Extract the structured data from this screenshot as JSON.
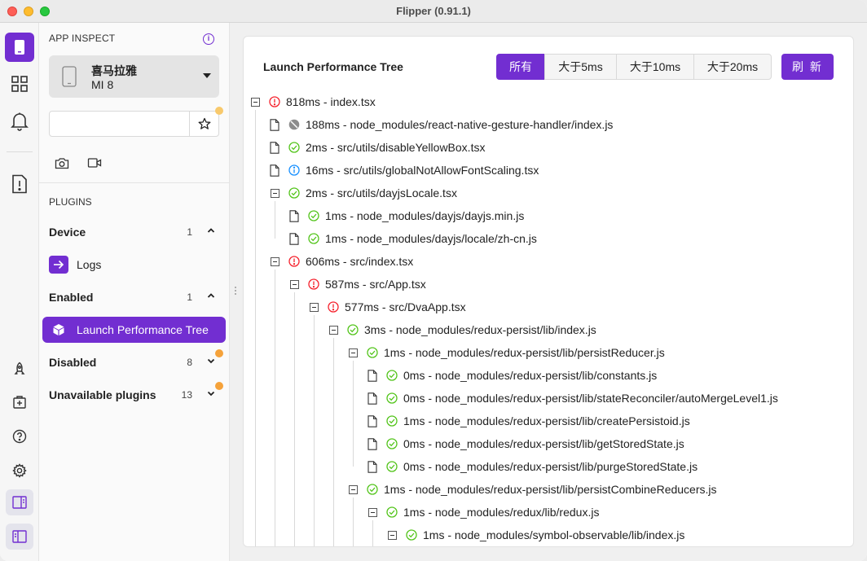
{
  "window": {
    "title": "Flipper (0.91.1)"
  },
  "sidebar": {
    "app_inspect_header": "APP INSPECT",
    "info_icon_glyph": "i",
    "device": {
      "name": "喜马拉雅",
      "model": "MI 8"
    },
    "search": {
      "value": "",
      "placeholder": ""
    },
    "plugins_header": "PLUGINS",
    "groups": {
      "device": {
        "label": "Device",
        "count": "1",
        "expanded": true
      },
      "enabled": {
        "label": "Enabled",
        "count": "1",
        "expanded": true
      },
      "disabled": {
        "label": "Disabled",
        "count": "8",
        "expanded": false
      },
      "unavailable": {
        "label": "Unavailable plugins",
        "count": "13",
        "expanded": false
      }
    },
    "plugins": {
      "logs": {
        "label": "Logs"
      },
      "launch_performance_tree": {
        "label": "Launch Performance Tree",
        "selected": true
      }
    }
  },
  "main": {
    "panel_title": "Launch Performance Tree",
    "filters": [
      {
        "label": "所有",
        "active": true
      },
      {
        "label": "大于5ms",
        "active": false
      },
      {
        "label": "大于10ms",
        "active": false
      },
      {
        "label": "大于20ms",
        "active": false
      }
    ],
    "refresh_label": "刷 新"
  },
  "colors": {
    "accent": "#722ed1",
    "status_error": "#f5222d",
    "status_ok": "#52c41a",
    "status_info": "#1890ff",
    "status_blocked": "#8c8c8c"
  },
  "tree": [
    {
      "depth": 0,
      "kind": "folder",
      "status": "error",
      "label": "818ms - index.tsx"
    },
    {
      "depth": 1,
      "kind": "file",
      "status": "blocked",
      "label": "188ms - node_modules/react-native-gesture-handler/index.js"
    },
    {
      "depth": 1,
      "kind": "file",
      "status": "ok",
      "label": "2ms - src/utils/disableYellowBox.tsx"
    },
    {
      "depth": 1,
      "kind": "file",
      "status": "info",
      "label": "16ms - src/utils/globalNotAllowFontScaling.tsx"
    },
    {
      "depth": 1,
      "kind": "folder",
      "status": "ok",
      "label": "2ms - src/utils/dayjsLocale.tsx"
    },
    {
      "depth": 2,
      "kind": "file",
      "status": "ok",
      "label": "1ms - node_modules/dayjs/dayjs.min.js"
    },
    {
      "depth": 2,
      "kind": "file",
      "status": "ok",
      "label": "1ms - node_modules/dayjs/locale/zh-cn.js"
    },
    {
      "depth": 1,
      "kind": "folder",
      "status": "error",
      "label": "606ms - src/index.tsx"
    },
    {
      "depth": 2,
      "kind": "folder",
      "status": "error",
      "label": "587ms - src/App.tsx"
    },
    {
      "depth": 3,
      "kind": "folder",
      "status": "error",
      "label": "577ms - src/DvaApp.tsx"
    },
    {
      "depth": 4,
      "kind": "folder",
      "status": "ok",
      "label": "3ms - node_modules/redux-persist/lib/index.js"
    },
    {
      "depth": 5,
      "kind": "folder",
      "status": "ok",
      "label": "1ms - node_modules/redux-persist/lib/persistReducer.js"
    },
    {
      "depth": 6,
      "kind": "file",
      "status": "ok",
      "label": "0ms - node_modules/redux-persist/lib/constants.js"
    },
    {
      "depth": 6,
      "kind": "file",
      "status": "ok",
      "label": "0ms - node_modules/redux-persist/lib/stateReconciler/autoMergeLevel1.js"
    },
    {
      "depth": 6,
      "kind": "file",
      "status": "ok",
      "label": "1ms - node_modules/redux-persist/lib/createPersistoid.js"
    },
    {
      "depth": 6,
      "kind": "file",
      "status": "ok",
      "label": "0ms - node_modules/redux-persist/lib/getStoredState.js"
    },
    {
      "depth": 6,
      "kind": "file",
      "status": "ok",
      "label": "0ms - node_modules/redux-persist/lib/purgeStoredState.js"
    },
    {
      "depth": 5,
      "kind": "folder",
      "status": "ok",
      "label": "1ms - node_modules/redux-persist/lib/persistCombineReducers.js"
    },
    {
      "depth": 6,
      "kind": "folder",
      "status": "ok",
      "label": "1ms - node_modules/redux/lib/redux.js"
    },
    {
      "depth": 7,
      "kind": "folder",
      "status": "ok",
      "label": "1ms - node_modules/symbol-observable/lib/index.js"
    }
  ]
}
